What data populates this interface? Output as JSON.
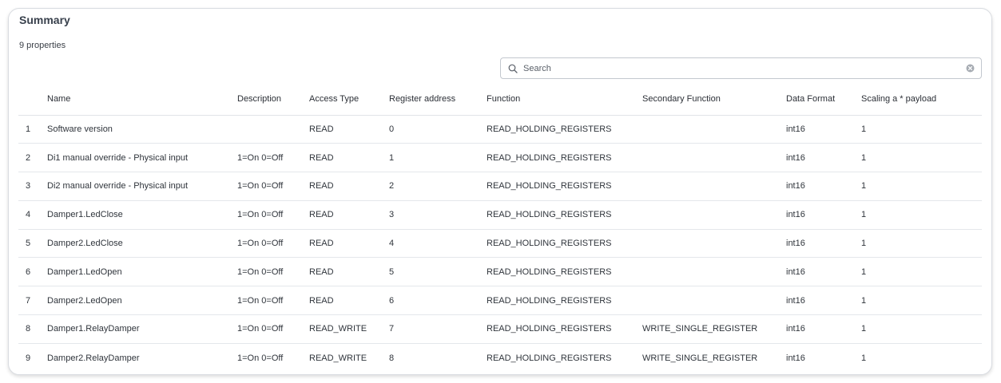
{
  "summary": {
    "title": "Summary",
    "count_label": "9 properties",
    "search": {
      "placeholder": "Search",
      "value": ""
    }
  },
  "table": {
    "headers": {
      "index": "",
      "name": "Name",
      "description": "Description",
      "access_type": "Access Type",
      "register_address": "Register address",
      "function": "Function",
      "secondary_function": "Secondary Function",
      "data_format": "Data Format",
      "scaling": "Scaling a * payload"
    },
    "rows": [
      {
        "index": "1",
        "name": "Software version",
        "description": "",
        "access_type": "READ",
        "register_address": "0",
        "function": "READ_HOLDING_REGISTERS",
        "secondary_function": "",
        "data_format": "int16",
        "scaling": "1"
      },
      {
        "index": "2",
        "name": "Di1 manual override - Physical input",
        "description": "1=On 0=Off",
        "access_type": "READ",
        "register_address": "1",
        "function": "READ_HOLDING_REGISTERS",
        "secondary_function": "",
        "data_format": "int16",
        "scaling": "1"
      },
      {
        "index": "3",
        "name": "Di2 manual override - Physical input",
        "description": "1=On 0=Off",
        "access_type": "READ",
        "register_address": "2",
        "function": "READ_HOLDING_REGISTERS",
        "secondary_function": "",
        "data_format": "int16",
        "scaling": "1"
      },
      {
        "index": "4",
        "name": "Damper1.LedClose",
        "description": "1=On 0=Off",
        "access_type": "READ",
        "register_address": "3",
        "function": "READ_HOLDING_REGISTERS",
        "secondary_function": "",
        "data_format": "int16",
        "scaling": "1"
      },
      {
        "index": "5",
        "name": "Damper2.LedClose",
        "description": "1=On 0=Off",
        "access_type": "READ",
        "register_address": "4",
        "function": "READ_HOLDING_REGISTERS",
        "secondary_function": "",
        "data_format": "int16",
        "scaling": "1"
      },
      {
        "index": "6",
        "name": "Damper1.LedOpen",
        "description": "1=On 0=Off",
        "access_type": "READ",
        "register_address": "5",
        "function": "READ_HOLDING_REGISTERS",
        "secondary_function": "",
        "data_format": "int16",
        "scaling": "1"
      },
      {
        "index": "7",
        "name": "Damper2.LedOpen",
        "description": "1=On 0=Off",
        "access_type": "READ",
        "register_address": "6",
        "function": "READ_HOLDING_REGISTERS",
        "secondary_function": "",
        "data_format": "int16",
        "scaling": "1"
      },
      {
        "index": "8",
        "name": "Damper1.RelayDamper",
        "description": "1=On 0=Off",
        "access_type": "READ_WRITE",
        "register_address": "7",
        "function": "READ_HOLDING_REGISTERS",
        "secondary_function": "WRITE_SINGLE_REGISTER",
        "data_format": "int16",
        "scaling": "1"
      },
      {
        "index": "9",
        "name": "Damper2.RelayDamper",
        "description": "1=On 0=Off",
        "access_type": "READ_WRITE",
        "register_address": "8",
        "function": "READ_HOLDING_REGISTERS",
        "secondary_function": "WRITE_SINGLE_REGISTER",
        "data_format": "int16",
        "scaling": "1"
      }
    ]
  },
  "icons": {
    "search": "search-icon",
    "clear": "clear-icon"
  }
}
